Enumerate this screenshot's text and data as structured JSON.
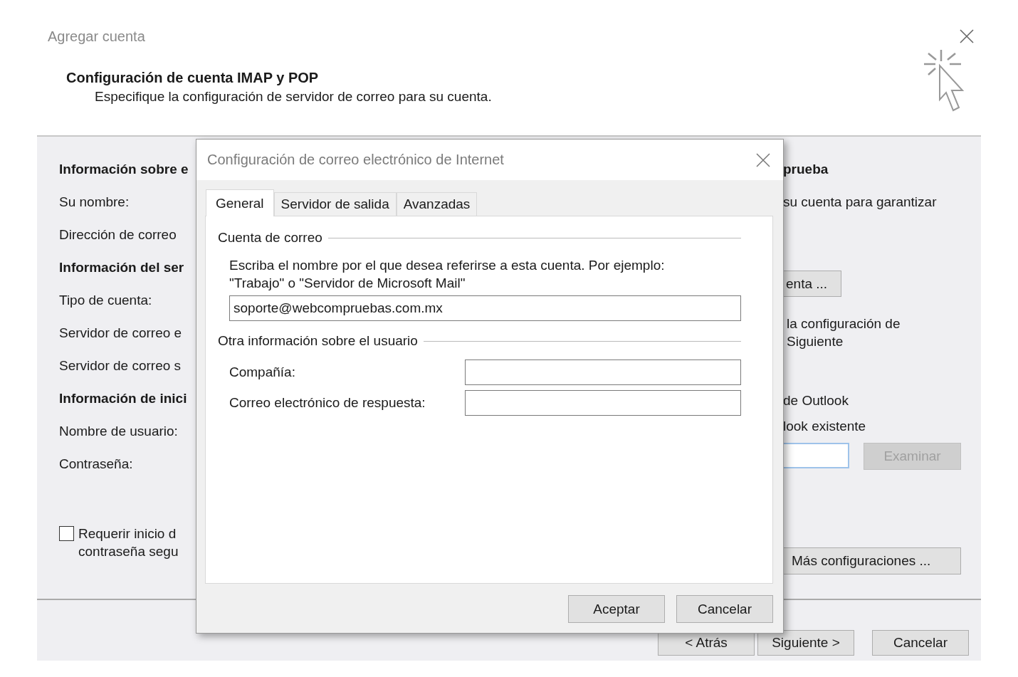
{
  "window": {
    "title": "Agregar cuenta"
  },
  "header": {
    "title": "Configuración de cuenta IMAP y POP",
    "subtitle": "Especifique la configuración de servidor de correo para su cuenta."
  },
  "left_panel": {
    "items": [
      {
        "kind": "heading",
        "text": "Información sobre e"
      },
      {
        "kind": "label",
        "text": "Su nombre:"
      },
      {
        "kind": "label",
        "text": "Dirección de correo"
      },
      {
        "kind": "heading",
        "text": "Información del ser"
      },
      {
        "kind": "label",
        "text": "Tipo de cuenta:"
      },
      {
        "kind": "label",
        "text": "Servidor de correo e"
      },
      {
        "kind": "label",
        "text": "Servidor de correo s"
      },
      {
        "kind": "heading",
        "text": "Información de inici"
      },
      {
        "kind": "label",
        "text": "Nombre de usuario:"
      },
      {
        "kind": "label",
        "text": "Contraseña:"
      }
    ],
    "checkbox": {
      "lines": [
        "Requerir inicio d",
        "contraseña segu"
      ],
      "checked": false
    }
  },
  "right_panel": {
    "heading": "prueba",
    "description": "su cuenta para garantizar",
    "test_button": {
      "label": "enta ..."
    },
    "note": [
      "la configuración de",
      "Siguiente"
    ],
    "outlook": [
      "de Outlook",
      "look existente"
    ],
    "browse_button": {
      "label": "Examinar",
      "disabled": true
    },
    "more_button": {
      "label": "Más configuraciones ..."
    }
  },
  "footer_buttons": [
    {
      "label": "< Atrás"
    },
    {
      "label": "Siguiente >"
    },
    {
      "label": "Cancelar"
    }
  ],
  "dialog": {
    "title": "Configuración de correo electrónico de Internet",
    "tabs": [
      {
        "label": "General",
        "selected": true
      },
      {
        "label": "Servidor de salida",
        "selected": false
      },
      {
        "label": "Avanzadas",
        "selected": false
      }
    ],
    "account_group": {
      "legend": "Cuenta de correo",
      "description": "Escriba el nombre por el que desea referirse a esta cuenta. Por ejemplo: \"Trabajo\" o \"Servidor de Microsoft Mail\"",
      "value": "soporte@webcompruebas.com.mx"
    },
    "user_group": {
      "legend": "Otra información sobre el usuario",
      "fields": [
        {
          "label": "Compañía:"
        },
        {
          "label": "Correo electrónico de respuesta:"
        }
      ]
    },
    "buttons": [
      {
        "label": "Aceptar"
      },
      {
        "label": "Cancelar"
      }
    ]
  }
}
